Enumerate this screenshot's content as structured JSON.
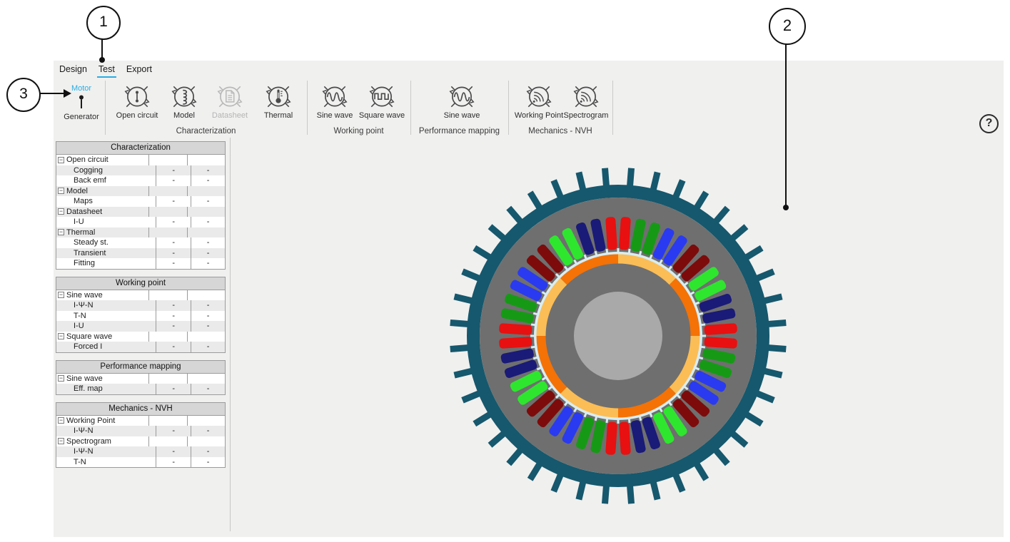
{
  "callouts": {
    "c1": "1",
    "c2": "2",
    "c3": "3"
  },
  "menu": {
    "items": [
      {
        "label": "Design",
        "active": false
      },
      {
        "label": "Test",
        "active": true
      },
      {
        "label": "Export",
        "active": false
      }
    ]
  },
  "ribbon": {
    "machine_toggle": {
      "top": "Motor",
      "bottom": "Generator"
    },
    "accent_color": "#29ade3",
    "groups": [
      {
        "label": "Characterization",
        "buttons": [
          {
            "label": "Open circuit",
            "icon": "open-circuit",
            "disabled": false
          },
          {
            "label": "Model",
            "icon": "coil",
            "disabled": false
          },
          {
            "label": "Datasheet",
            "icon": "datasheet",
            "disabled": true
          },
          {
            "label": "Thermal",
            "icon": "thermometer",
            "disabled": false
          }
        ]
      },
      {
        "label": "Working point",
        "buttons": [
          {
            "label": "Sine wave",
            "icon": "sine",
            "disabled": false
          },
          {
            "label": "Square wave",
            "icon": "square",
            "disabled": false
          }
        ]
      },
      {
        "label": "Performance mapping",
        "buttons": [
          {
            "label": "Sine wave",
            "icon": "sine",
            "disabled": false
          }
        ]
      },
      {
        "label": "Mechanics - NVH",
        "buttons": [
          {
            "label": "Working Point",
            "icon": "nvh",
            "disabled": false
          },
          {
            "label": "Spectrogram",
            "icon": "nvh",
            "disabled": false
          }
        ]
      }
    ],
    "help_label": "?"
  },
  "tables": [
    {
      "title": "Characterization",
      "rows": [
        {
          "label": "Open circuit",
          "group": true
        },
        {
          "label": "Cogging",
          "v1": "-",
          "v2": "-"
        },
        {
          "label": "Back emf",
          "v1": "-",
          "v2": "-"
        },
        {
          "label": "Model",
          "group": true
        },
        {
          "label": "Maps",
          "v1": "-",
          "v2": "-"
        },
        {
          "label": "Datasheet",
          "group": true
        },
        {
          "label": "I-U",
          "v1": "-",
          "v2": "-"
        },
        {
          "label": "Thermal",
          "group": true
        },
        {
          "label": "Steady st.",
          "v1": "-",
          "v2": "-"
        },
        {
          "label": "Transient",
          "v1": "-",
          "v2": "-"
        },
        {
          "label": "Fitting",
          "v1": "-",
          "v2": "-"
        }
      ]
    },
    {
      "title": "Working point",
      "rows": [
        {
          "label": "Sine wave",
          "group": true
        },
        {
          "label": "I-Ψ-N",
          "v1": "-",
          "v2": "-"
        },
        {
          "label": "T-N",
          "v1": "-",
          "v2": "-"
        },
        {
          "label": "I-U",
          "v1": "-",
          "v2": "-"
        },
        {
          "label": "Square wave",
          "group": true
        },
        {
          "label": "Forced I",
          "v1": "-",
          "v2": "-"
        }
      ]
    },
    {
      "title": "Performance mapping",
      "rows": [
        {
          "label": "Sine wave",
          "group": true
        },
        {
          "label": "Eff. map",
          "v1": "-",
          "v2": "-"
        }
      ]
    },
    {
      "title": "Mechanics - NVH",
      "rows": [
        {
          "label": "Working Point",
          "group": true
        },
        {
          "label": "I-Ψ-N",
          "v1": "-",
          "v2": "-"
        },
        {
          "label": "Spectrogram",
          "group": true
        },
        {
          "label": "I-Ψ-N",
          "v1": "-",
          "v2": "-"
        },
        {
          "label": "T-N",
          "v1": "-",
          "v2": "-"
        }
      ]
    }
  ],
  "motor": {
    "slot_count": 48,
    "fin_count": 40,
    "magnet_segments": 8,
    "slot_pattern_cw_from_top": [
      "red",
      "green",
      "green",
      "blue",
      "blue",
      "maroon",
      "maroon",
      "lime",
      "lime",
      "navy",
      "navy",
      "red"
    ],
    "colors": {
      "housing": "#16586d",
      "core_gray": "#6f6f6f",
      "shaft": "#a9a9a9",
      "airgap": "#d8edf3",
      "magnet_a": "#fbbd55",
      "magnet_b": "#f47206",
      "red": "#e81010",
      "green": "#169a16",
      "blue": "#2a3af0",
      "maroon": "#7d0b0b",
      "lime": "#2ee62e",
      "navy": "#1a1a78"
    }
  }
}
